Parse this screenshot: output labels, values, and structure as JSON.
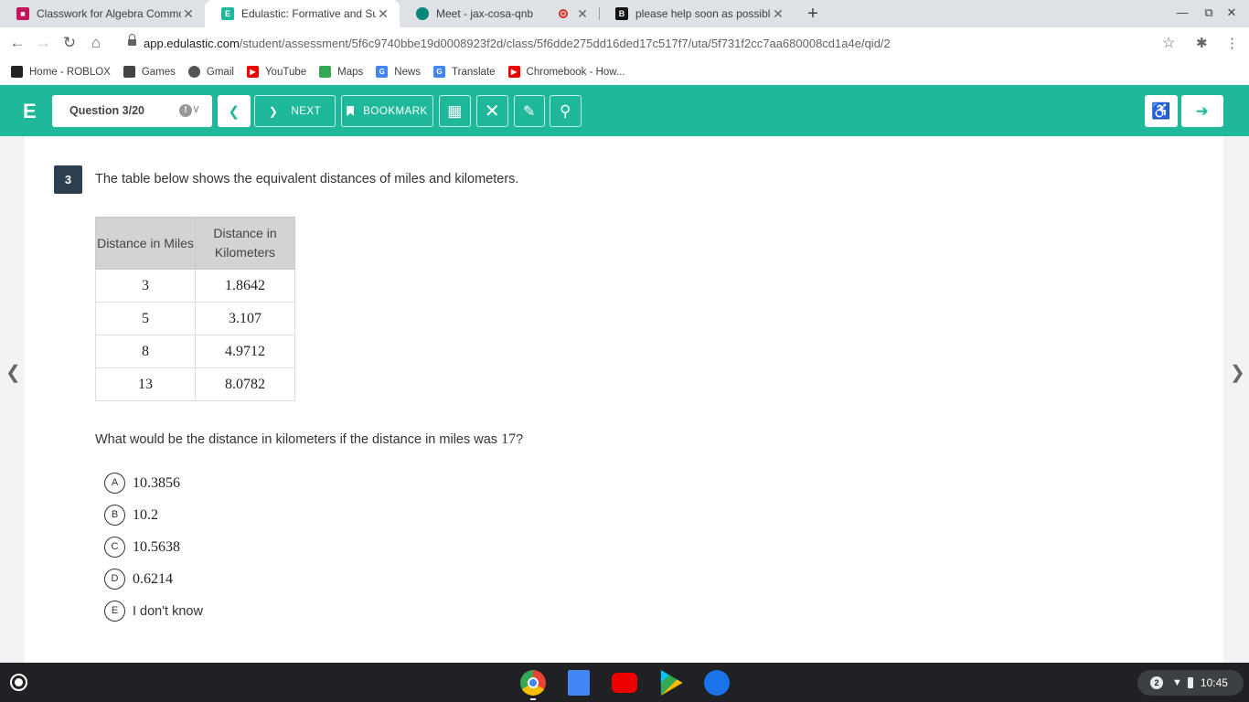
{
  "browser": {
    "tabs": [
      {
        "title": "Classwork for Algebra Common",
        "favicon": "classroom-icon"
      },
      {
        "title": "Edulastic: Formative and Summ",
        "favicon": "edulastic-icon",
        "active": true
      },
      {
        "title": "Meet - jax-cosa-qnb",
        "favicon": "meet-icon",
        "recording": true
      },
      {
        "title": "please help soon as possible - Br",
        "favicon": "brainly-icon"
      }
    ],
    "url_host": "app.edulastic.com",
    "url_path": "/student/assessment/5f6c9740bbe19d0008923f2d/class/5f6dde275dd16ded17c517f7/uta/5f731f2cc7aa680008cd1a4e/qid/2",
    "bookmarks": [
      "Home - ROBLOX",
      "Games",
      "Gmail",
      "YouTube",
      "Maps",
      "News",
      "Translate",
      "Chromebook - How..."
    ]
  },
  "app": {
    "logo": "E",
    "question_selector": "Question 3/20",
    "next_label": "NEXT",
    "bookmark_label": "BOOKMARK",
    "accent_color": "#1fb89b"
  },
  "question": {
    "number": "3",
    "stem": "The table below shows the equivalent distances of miles and kilometers.",
    "table": {
      "headers": [
        "Distance in Miles",
        "Distance in Kilometers"
      ],
      "rows": [
        [
          "3",
          "1.8642"
        ],
        [
          "5",
          "3.107"
        ],
        [
          "8",
          "4.9712"
        ],
        [
          "13",
          "8.0782"
        ]
      ]
    },
    "ask_prefix": "What would be the distance in kilometers if the distance in miles was ",
    "ask_value": "17",
    "ask_suffix": "?",
    "choices": [
      {
        "letter": "A",
        "text": "10.3856"
      },
      {
        "letter": "B",
        "text": "10.2"
      },
      {
        "letter": "C",
        "text": "10.5638"
      },
      {
        "letter": "D",
        "text": "0.6214"
      },
      {
        "letter": "E",
        "text": "I don't know"
      }
    ]
  },
  "shelf": {
    "notification_count": "2",
    "time": "10:45"
  }
}
